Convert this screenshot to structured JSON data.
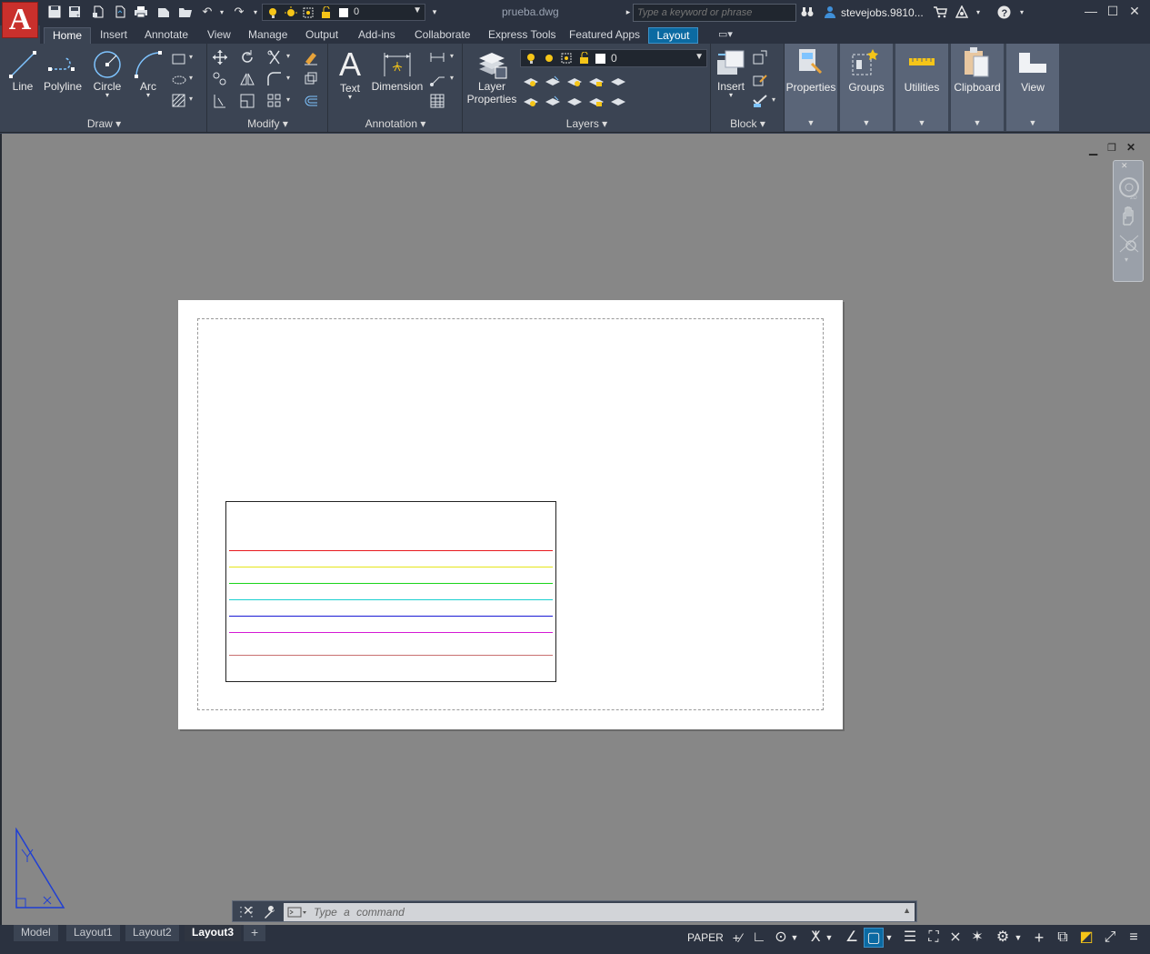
{
  "app": {
    "logo_letter": "A",
    "file_title": "prueba.dwg"
  },
  "quick_access": {
    "icons": [
      "new-icon",
      "save-icon",
      "save-as-icon",
      "open-from-web-icon",
      "print-icon",
      "plot-icon",
      "open-icon",
      "undo-icon",
      "redo-icon"
    ],
    "layer_value": "0"
  },
  "search": {
    "placeholder": "Type a keyword or phrase"
  },
  "user": {
    "name": "stevejobs.9810..."
  },
  "ribbon_tabs": [
    {
      "label": "Home"
    },
    {
      "label": "Insert"
    },
    {
      "label": "Annotate"
    },
    {
      "label": "View"
    },
    {
      "label": "Manage"
    },
    {
      "label": "Output"
    },
    {
      "label": "Add-ins"
    },
    {
      "label": "Collaborate"
    },
    {
      "label": "Express Tools"
    },
    {
      "label": "Featured Apps"
    },
    {
      "label": "Layout"
    }
  ],
  "panels": {
    "draw": {
      "title": "Draw",
      "line": "Line",
      "polyline": "Polyline",
      "circle": "Circle",
      "arc": "Arc"
    },
    "modify": {
      "title": "Modify"
    },
    "annotation": {
      "title": "Annotation",
      "text": "Text",
      "dimension": "Dimension"
    },
    "layers": {
      "title": "Layers",
      "layer_properties_1": "Layer",
      "layer_properties_2": "Properties",
      "layer_value": "0"
    },
    "block": {
      "title": "Block",
      "insert": "Insert"
    },
    "properties": {
      "label": "Properties"
    },
    "groups": {
      "label": "Groups"
    },
    "utilities": {
      "label": "Utilities"
    },
    "clipboard": {
      "label": "Clipboard"
    },
    "view": {
      "label": "View"
    }
  },
  "viewport_lines": [
    {
      "color": "#e8191e"
    },
    {
      "color": "#e6e61a"
    },
    {
      "color": "#1ad41a"
    },
    {
      "color": "#1ad0d0"
    },
    {
      "color": "#1a1ad4"
    },
    {
      "color": "#d41ad4"
    },
    {
      "color": "#c87070"
    }
  ],
  "command": {
    "placeholder": "Type  a  command"
  },
  "layout_tabs": [
    {
      "label": "Model"
    },
    {
      "label": "Layout1"
    },
    {
      "label": "Layout2"
    },
    {
      "label": "Layout3"
    }
  ],
  "status": {
    "paper_label": "PAPER"
  }
}
